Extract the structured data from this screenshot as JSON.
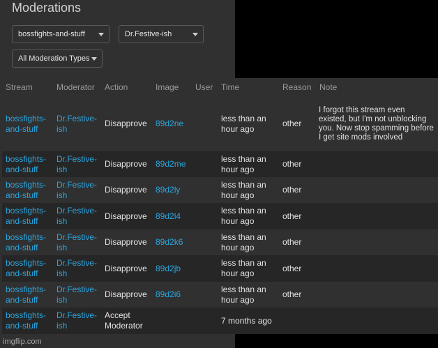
{
  "page": {
    "title": "Moderations"
  },
  "filters": {
    "stream": "bossfights-and-stuff",
    "moderator": "Dr.Festive-ish",
    "type": "All Moderation Types"
  },
  "table": {
    "headers": [
      "Stream",
      "Moderator",
      "Action",
      "Image",
      "User",
      "Time",
      "Reason",
      "Note"
    ],
    "rows": [
      {
        "stream": "bossfights-and-stuff",
        "moderator": "Dr.Festive-ish",
        "action": "Disapprove",
        "image": "89d2ne",
        "time": "less than an hour ago",
        "reason": "other",
        "note": "I forgot this stream even existed, but I'm not unblocking you. Now stop spamming before I get site mods involved"
      },
      {
        "stream": "bossfights-and-stuff",
        "moderator": "Dr.Festive-ish",
        "action": "Disapprove",
        "image": "89d2me",
        "time": "less than an hour ago",
        "reason": "other",
        "note": ""
      },
      {
        "stream": "bossfights-and-stuff",
        "moderator": "Dr.Festive-ish",
        "action": "Disapprove",
        "image": "89d2ly",
        "time": "less than an hour ago",
        "reason": "other",
        "note": ""
      },
      {
        "stream": "bossfights-and-stuff",
        "moderator": "Dr.Festive-ish",
        "action": "Disapprove",
        "image": "89d2l4",
        "time": "less than an hour ago",
        "reason": "other",
        "note": ""
      },
      {
        "stream": "bossfights-and-stuff",
        "moderator": "Dr.Festive-ish",
        "action": "Disapprove",
        "image": "89d2k6",
        "time": "less than an hour ago",
        "reason": "other",
        "note": ""
      },
      {
        "stream": "bossfights-and-stuff",
        "moderator": "Dr.Festive-ish",
        "action": "Disapprove",
        "image": "89d2jb",
        "time": "less than an hour ago",
        "reason": "other",
        "note": ""
      },
      {
        "stream": "bossfights-and-stuff",
        "moderator": "Dr.Festive-ish",
        "action": "Disapprove",
        "image": "89d2i6",
        "time": "less than an hour ago",
        "reason": "other",
        "note": ""
      },
      {
        "stream": "bossfights-and-stuff",
        "moderator": "Dr.Festive-ish",
        "action": "Accept Moderator",
        "image": "",
        "time": "7 months ago",
        "reason": "",
        "note": ""
      }
    ]
  },
  "watermark": "imgflip.com",
  "colors": {
    "link": "#2aa6e0",
    "background": "#303030",
    "row_alt": "#262626"
  }
}
